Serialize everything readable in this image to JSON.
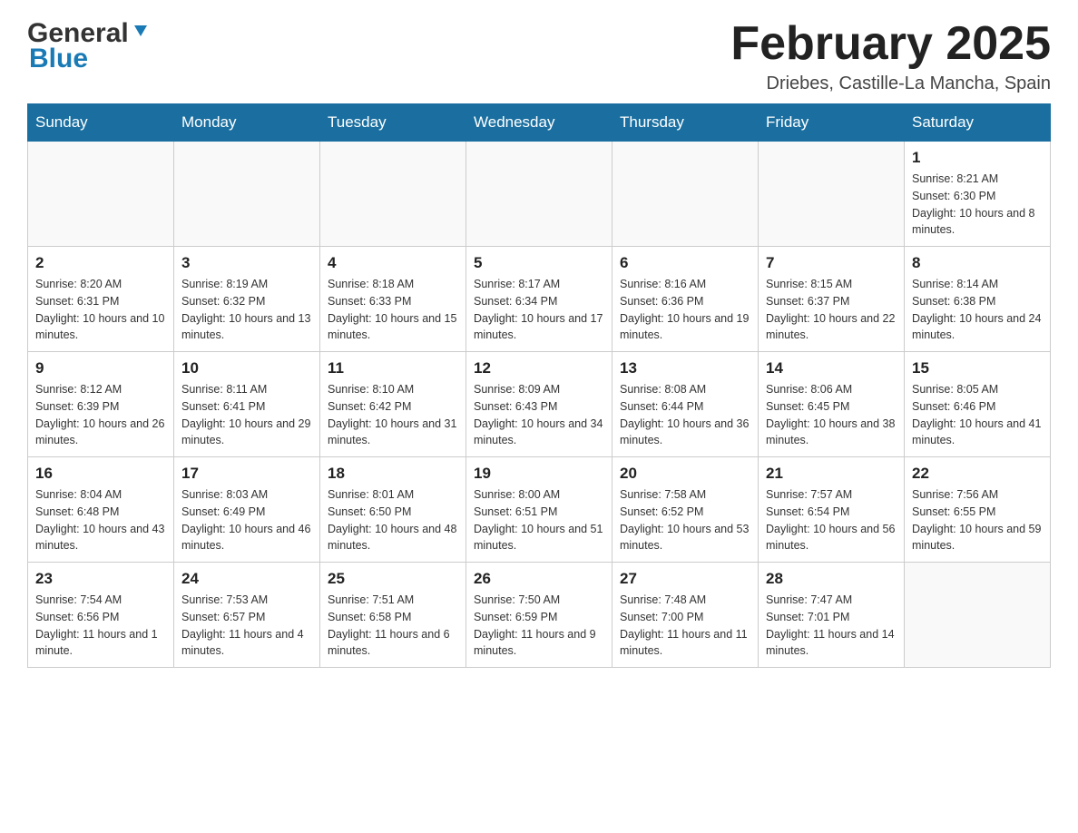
{
  "header": {
    "logo_general": "General",
    "logo_blue": "Blue",
    "month_title": "February 2025",
    "location": "Driebes, Castille-La Mancha, Spain"
  },
  "weekdays": [
    "Sunday",
    "Monday",
    "Tuesday",
    "Wednesday",
    "Thursday",
    "Friday",
    "Saturday"
  ],
  "weeks": [
    [
      {
        "day": "",
        "info": ""
      },
      {
        "day": "",
        "info": ""
      },
      {
        "day": "",
        "info": ""
      },
      {
        "day": "",
        "info": ""
      },
      {
        "day": "",
        "info": ""
      },
      {
        "day": "",
        "info": ""
      },
      {
        "day": "1",
        "info": "Sunrise: 8:21 AM\nSunset: 6:30 PM\nDaylight: 10 hours and 8 minutes."
      }
    ],
    [
      {
        "day": "2",
        "info": "Sunrise: 8:20 AM\nSunset: 6:31 PM\nDaylight: 10 hours and 10 minutes."
      },
      {
        "day": "3",
        "info": "Sunrise: 8:19 AM\nSunset: 6:32 PM\nDaylight: 10 hours and 13 minutes."
      },
      {
        "day": "4",
        "info": "Sunrise: 8:18 AM\nSunset: 6:33 PM\nDaylight: 10 hours and 15 minutes."
      },
      {
        "day": "5",
        "info": "Sunrise: 8:17 AM\nSunset: 6:34 PM\nDaylight: 10 hours and 17 minutes."
      },
      {
        "day": "6",
        "info": "Sunrise: 8:16 AM\nSunset: 6:36 PM\nDaylight: 10 hours and 19 minutes."
      },
      {
        "day": "7",
        "info": "Sunrise: 8:15 AM\nSunset: 6:37 PM\nDaylight: 10 hours and 22 minutes."
      },
      {
        "day": "8",
        "info": "Sunrise: 8:14 AM\nSunset: 6:38 PM\nDaylight: 10 hours and 24 minutes."
      }
    ],
    [
      {
        "day": "9",
        "info": "Sunrise: 8:12 AM\nSunset: 6:39 PM\nDaylight: 10 hours and 26 minutes."
      },
      {
        "day": "10",
        "info": "Sunrise: 8:11 AM\nSunset: 6:41 PM\nDaylight: 10 hours and 29 minutes."
      },
      {
        "day": "11",
        "info": "Sunrise: 8:10 AM\nSunset: 6:42 PM\nDaylight: 10 hours and 31 minutes."
      },
      {
        "day": "12",
        "info": "Sunrise: 8:09 AM\nSunset: 6:43 PM\nDaylight: 10 hours and 34 minutes."
      },
      {
        "day": "13",
        "info": "Sunrise: 8:08 AM\nSunset: 6:44 PM\nDaylight: 10 hours and 36 minutes."
      },
      {
        "day": "14",
        "info": "Sunrise: 8:06 AM\nSunset: 6:45 PM\nDaylight: 10 hours and 38 minutes."
      },
      {
        "day": "15",
        "info": "Sunrise: 8:05 AM\nSunset: 6:46 PM\nDaylight: 10 hours and 41 minutes."
      }
    ],
    [
      {
        "day": "16",
        "info": "Sunrise: 8:04 AM\nSunset: 6:48 PM\nDaylight: 10 hours and 43 minutes."
      },
      {
        "day": "17",
        "info": "Sunrise: 8:03 AM\nSunset: 6:49 PM\nDaylight: 10 hours and 46 minutes."
      },
      {
        "day": "18",
        "info": "Sunrise: 8:01 AM\nSunset: 6:50 PM\nDaylight: 10 hours and 48 minutes."
      },
      {
        "day": "19",
        "info": "Sunrise: 8:00 AM\nSunset: 6:51 PM\nDaylight: 10 hours and 51 minutes."
      },
      {
        "day": "20",
        "info": "Sunrise: 7:58 AM\nSunset: 6:52 PM\nDaylight: 10 hours and 53 minutes."
      },
      {
        "day": "21",
        "info": "Sunrise: 7:57 AM\nSunset: 6:54 PM\nDaylight: 10 hours and 56 minutes."
      },
      {
        "day": "22",
        "info": "Sunrise: 7:56 AM\nSunset: 6:55 PM\nDaylight: 10 hours and 59 minutes."
      }
    ],
    [
      {
        "day": "23",
        "info": "Sunrise: 7:54 AM\nSunset: 6:56 PM\nDaylight: 11 hours and 1 minute."
      },
      {
        "day": "24",
        "info": "Sunrise: 7:53 AM\nSunset: 6:57 PM\nDaylight: 11 hours and 4 minutes."
      },
      {
        "day": "25",
        "info": "Sunrise: 7:51 AM\nSunset: 6:58 PM\nDaylight: 11 hours and 6 minutes."
      },
      {
        "day": "26",
        "info": "Sunrise: 7:50 AM\nSunset: 6:59 PM\nDaylight: 11 hours and 9 minutes."
      },
      {
        "day": "27",
        "info": "Sunrise: 7:48 AM\nSunset: 7:00 PM\nDaylight: 11 hours and 11 minutes."
      },
      {
        "day": "28",
        "info": "Sunrise: 7:47 AM\nSunset: 7:01 PM\nDaylight: 11 hours and 14 minutes."
      },
      {
        "day": "",
        "info": ""
      }
    ]
  ]
}
